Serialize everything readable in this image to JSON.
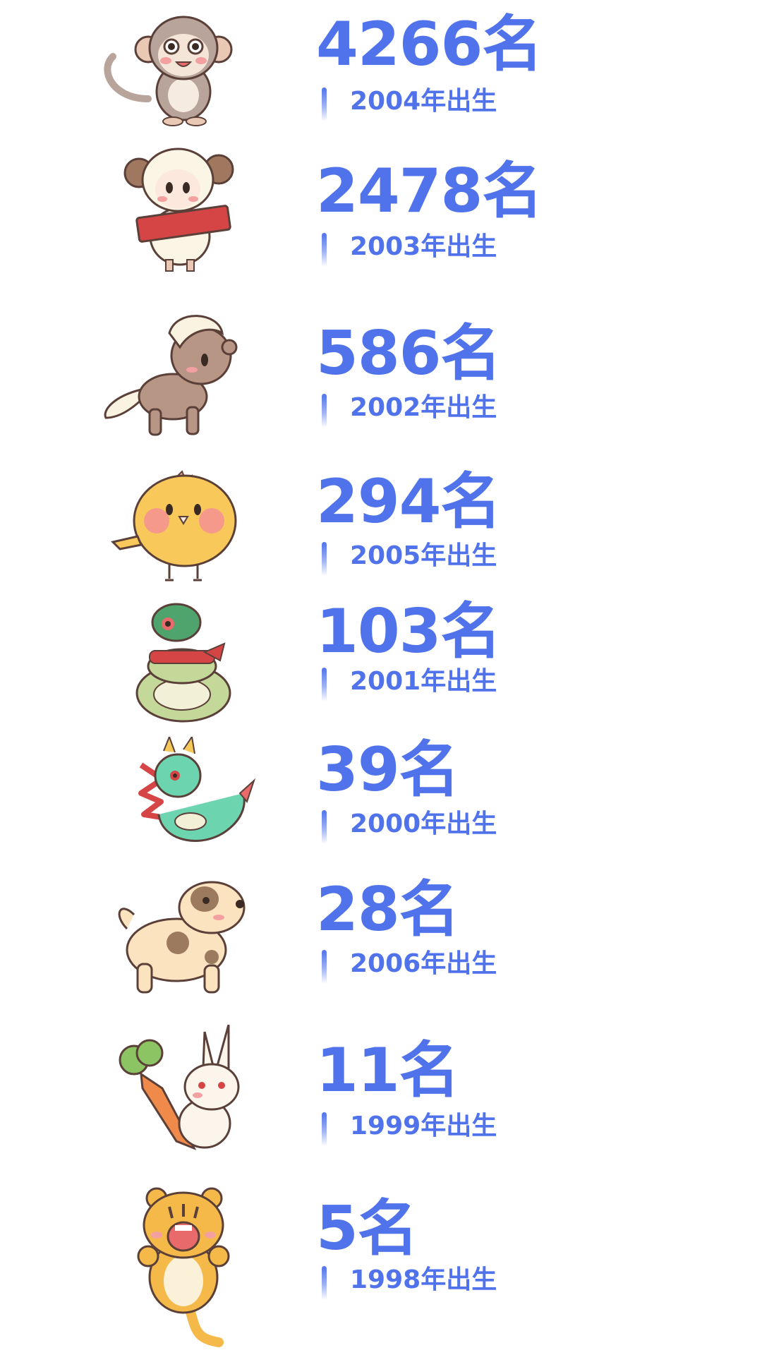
{
  "accent": "#5073eb",
  "rows": [
    {
      "animal_icon": "monkey-icon",
      "count": "4266名",
      "year": "2004年出生"
    },
    {
      "animal_icon": "sheep-icon",
      "count": "2478名",
      "year": "2003年出生"
    },
    {
      "animal_icon": "horse-icon",
      "count": "586名",
      "year": "2002年出生"
    },
    {
      "animal_icon": "rooster-icon",
      "count": "294名",
      "year": "2005年出生"
    },
    {
      "animal_icon": "snake-icon",
      "count": "103名",
      "year": "2001年出生"
    },
    {
      "animal_icon": "dragon-icon",
      "count": "39名",
      "year": "2000年出生"
    },
    {
      "animal_icon": "dog-icon",
      "count": "28名",
      "year": "2006年出生"
    },
    {
      "animal_icon": "rabbit-icon",
      "count": "11名",
      "year": "1999年出生"
    },
    {
      "animal_icon": "tiger-icon",
      "count": "5名",
      "year": "1998年出生"
    }
  ]
}
